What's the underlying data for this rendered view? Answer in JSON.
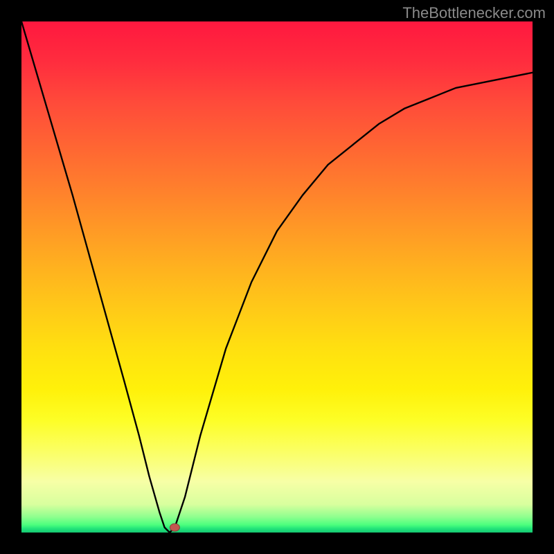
{
  "watermark": "TheBottlenecker.com",
  "chart_data": {
    "type": "line",
    "title": "",
    "xlabel": "",
    "ylabel": "",
    "xlim": [
      0,
      100
    ],
    "ylim": [
      0,
      100
    ],
    "grid": false,
    "legend": false,
    "series": [
      {
        "name": "curve",
        "x": [
          0,
          5,
          10,
          15,
          20,
          23,
          25,
          27,
          28,
          29,
          30,
          32,
          35,
          40,
          45,
          50,
          55,
          60,
          65,
          70,
          75,
          80,
          85,
          90,
          95,
          100
        ],
        "y": [
          100,
          83,
          66,
          48,
          30,
          19,
          11,
          4,
          1,
          0,
          1,
          7,
          19,
          36,
          49,
          59,
          66,
          72,
          76,
          80,
          83,
          85,
          87,
          88,
          89,
          90
        ]
      }
    ],
    "marker": {
      "x": 30,
      "y": 1,
      "color": "#c2574f"
    },
    "background_gradient": {
      "direction": "top-to-bottom",
      "stops": [
        {
          "pos": 0.0,
          "color": "#ff183f"
        },
        {
          "pos": 0.5,
          "color": "#ffc918"
        },
        {
          "pos": 0.8,
          "color": "#fdfe26"
        },
        {
          "pos": 1.0,
          "color": "#17c872"
        }
      ]
    }
  }
}
